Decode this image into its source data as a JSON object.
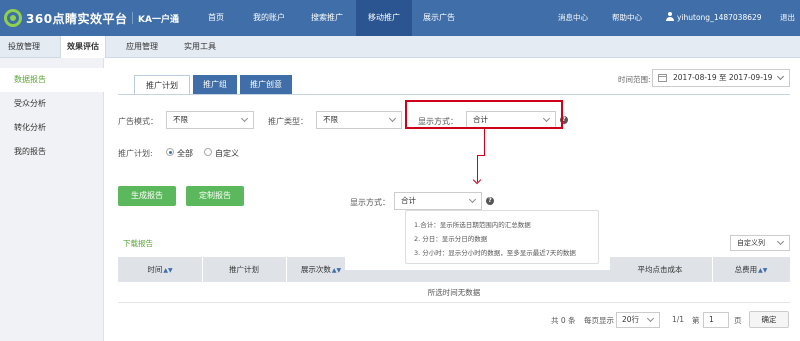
{
  "topbar": {
    "logo_text": "360点睛实效平台",
    "ka": "KA一户通",
    "nav": [
      "首页",
      "我的账户",
      "搜索推广",
      "移动推广",
      "展示广告"
    ],
    "message_center": "消息中心",
    "help_center": "帮助中心",
    "username": "yihutong_1487038629",
    "logout": "退出"
  },
  "subnav": [
    "投放管理",
    "效果评估",
    "应用管理",
    "实用工具"
  ],
  "sidebar": [
    "数据报告",
    "受众分析",
    "转化分析",
    "我的报告"
  ],
  "tabs": [
    "推广计划",
    "推广组",
    "推广创意"
  ],
  "time_range": {
    "label": "时间范围:",
    "value": "2017-08-19 至 2017-09-19"
  },
  "filters": {
    "ad_mode_label": "广告模式：",
    "ad_mode_value": "不限",
    "promo_type_label": "推广类型：",
    "promo_type_value": "不限",
    "display_label": "显示方式：",
    "display_value": "合计",
    "plan_label": "推广计划:",
    "radio_all": "全部",
    "radio_custom": "自定义"
  },
  "buttons": {
    "generate": "生成报告",
    "custom": "定制报告"
  },
  "popup": {
    "display_label": "显示方式：",
    "display_value": "合计",
    "tips": [
      "1.合计：显示所选日期范围内的汇总数据",
      "2. 分日：显示分日的数据",
      "3. 分小时：显示分小时的数据，至多显示最近7天的数据"
    ]
  },
  "table": {
    "download": "下载报告",
    "custom_columns": "自定义列",
    "headers": [
      "时间",
      "推广计划",
      "展示次数",
      "平均点击成本",
      "总费用"
    ],
    "empty": "所选时间无数据"
  },
  "pagination": {
    "total": "共 0 条",
    "per_page_label": "每页显示",
    "per_page_value": "20行",
    "page_status": "1/1",
    "goto_label": "第",
    "goto_value": "1",
    "page_unit": "页",
    "confirm": "确定"
  }
}
